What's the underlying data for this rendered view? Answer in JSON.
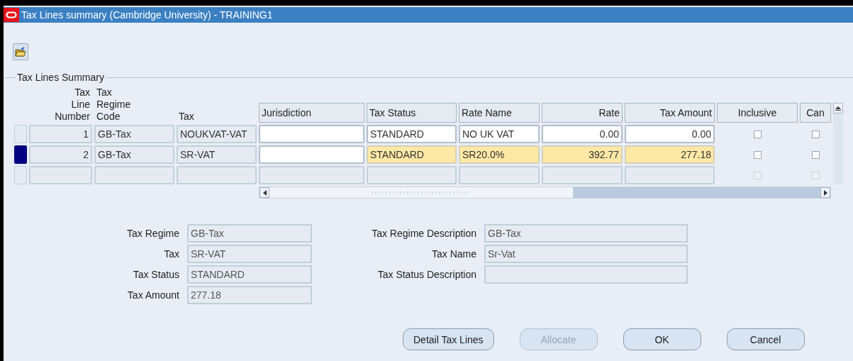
{
  "window": {
    "title": "Tax Lines summary (Cambridge University) - TRAINING1"
  },
  "table": {
    "group_title": "Tax Lines Summary",
    "columns": [
      {
        "label_lines": [
          "Tax",
          "Line",
          "Number"
        ],
        "kind": "readonly-number"
      },
      {
        "label_lines": [
          "Tax",
          "Regime",
          "Code"
        ],
        "kind": "readonly"
      },
      {
        "label_lines": [
          "Tax"
        ],
        "kind": "readonly"
      },
      {
        "label_lines": [
          "Jurisdiction"
        ],
        "kind": "text"
      },
      {
        "label_lines": [
          "Tax Status"
        ],
        "kind": "text"
      },
      {
        "label_lines": [
          "Rate Name"
        ],
        "kind": "text"
      },
      {
        "label_lines": [
          "Rate"
        ],
        "kind": "number"
      },
      {
        "label_lines": [
          "Tax Amount"
        ],
        "kind": "number"
      },
      {
        "label_lines": [
          "Inclusive"
        ],
        "kind": "check"
      },
      {
        "label_lines": [
          "Can"
        ],
        "kind": "check"
      }
    ],
    "rows": [
      {
        "selected": false,
        "disabled": false,
        "cells": [
          "1",
          "GB-Tax",
          "NOUKVAT-VAT",
          null,
          "STANDARD",
          "NO UK VAT",
          "0.00",
          "0.00",
          false,
          false
        ]
      },
      {
        "selected": true,
        "disabled": false,
        "cells": [
          "2",
          "GB-Tax",
          "SR-VAT",
          null,
          "STANDARD",
          "SR20.0%",
          "392.77",
          "277.18",
          false,
          false
        ]
      },
      {
        "selected": false,
        "disabled": true,
        "cells": [
          null,
          null,
          null,
          null,
          null,
          null,
          null,
          null,
          false,
          false
        ]
      }
    ]
  },
  "details": {
    "left": [
      {
        "label": "Tax Regime",
        "value": "GB-Tax"
      },
      {
        "label": "Tax",
        "value": "SR-VAT"
      },
      {
        "label": "Tax Status",
        "value": "STANDARD"
      },
      {
        "label": "Tax Amount",
        "value": "277.18"
      }
    ],
    "right": [
      {
        "label": "Tax Regime Description",
        "value": "GB-Tax"
      },
      {
        "label": "Tax Name",
        "value": "Sr-Vat"
      },
      {
        "label": "Tax Status Description"
      }
    ]
  },
  "buttons": [
    {
      "label": "Detail Tax Lines",
      "disabled": false
    },
    {
      "label": "Allocate",
      "disabled": true
    },
    {
      "label": "OK",
      "disabled": false
    },
    {
      "label": "Cancel",
      "disabled": false
    }
  ]
}
